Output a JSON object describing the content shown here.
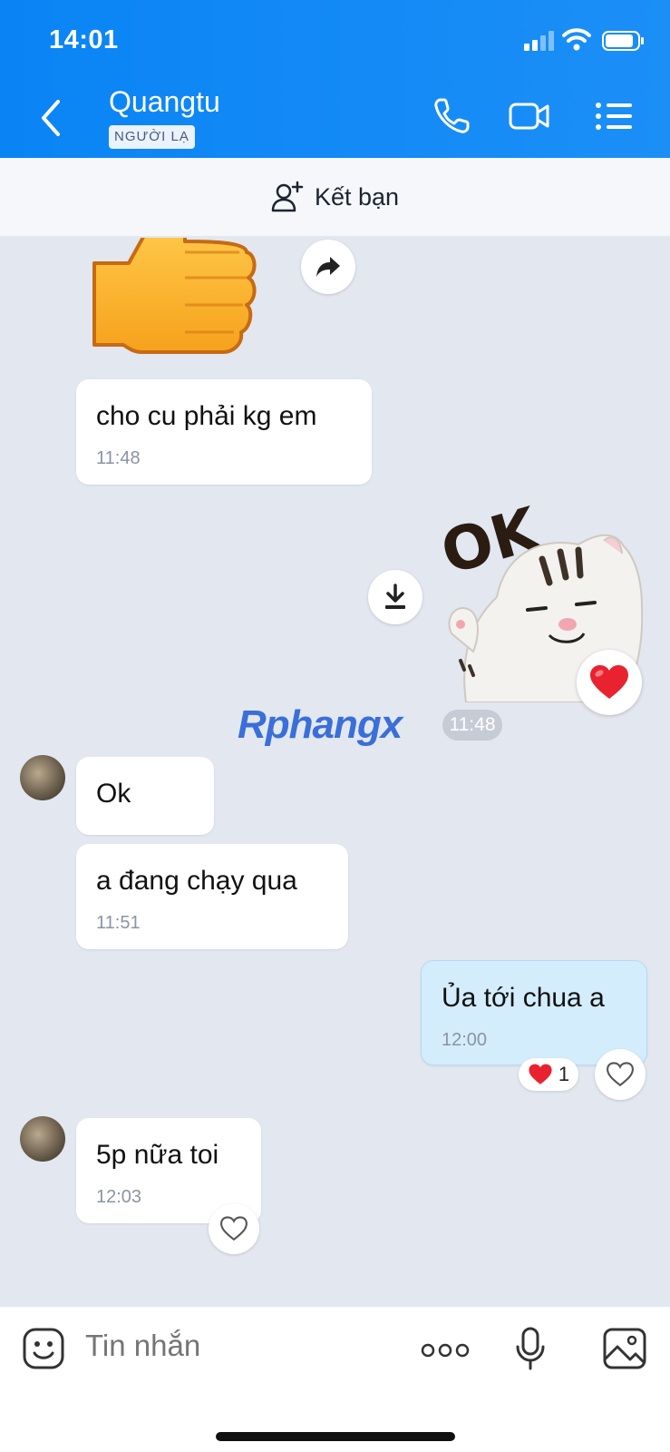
{
  "status_bar": {
    "time": "14:01"
  },
  "header": {
    "contact_name": "Quangtu",
    "badge": "NGƯỜI LẠ",
    "icons": [
      "back-icon",
      "phone-icon",
      "video-call-icon",
      "menu-list-icon"
    ]
  },
  "friend_bar": {
    "label": "Kết bạn",
    "icon": "add-friend-icon"
  },
  "messages": [
    {
      "type": "sticker",
      "side": "left",
      "sticker": "thumbs-up"
    },
    {
      "type": "text",
      "side": "left",
      "text": "cho cu phải kg em",
      "time": "11:48"
    },
    {
      "type": "sticker",
      "side": "right",
      "sticker": "ok-cat",
      "sticker_text": "OK",
      "reaction": "heart"
    },
    {
      "type": "text",
      "side": "left",
      "text": "Ok"
    },
    {
      "type": "text",
      "side": "left",
      "text": "a đang chạy qua",
      "time": "11:51"
    },
    {
      "type": "text",
      "side": "right",
      "text": "Ủa tới chua a",
      "time": "12:00",
      "reaction_count": "1"
    },
    {
      "type": "text",
      "side": "left",
      "text": "5p nữa toi",
      "time": "12:03"
    }
  ],
  "separator_time": "11:48",
  "watermark": "Rphangx",
  "composer": {
    "placeholder": "Tin nhắn",
    "icons": [
      "emoji-icon",
      "more-icon",
      "microphone-icon",
      "image-icon"
    ]
  },
  "colors": {
    "header": "#0a84f5",
    "chat_bg": "#e2e7f0",
    "my_bubble": "#d4edfd",
    "heart": "#e8232f"
  }
}
